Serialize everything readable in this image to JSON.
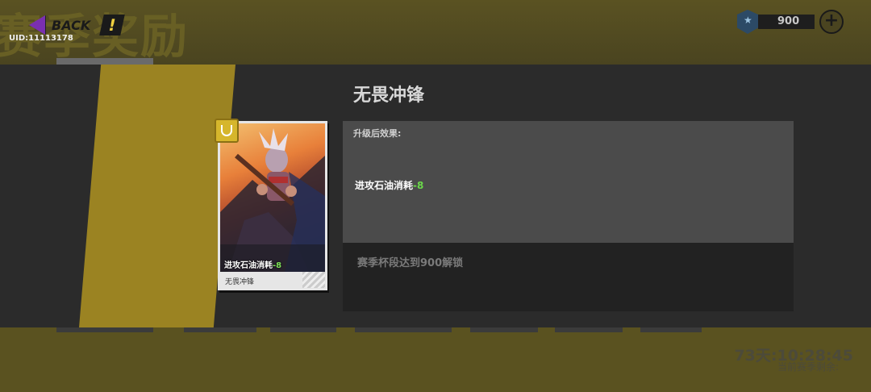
{
  "header": {
    "bg_title": "赛季奖励",
    "back_label": "BACK",
    "info_label": "!",
    "uid": "UID:11113178"
  },
  "currency": {
    "icon": "trophy-shield-icon",
    "value": "900",
    "add_label": "+"
  },
  "footer": {
    "timer": "73天:10:28:45",
    "timer_label": "当前赛季剩余:"
  },
  "card": {
    "badge_icon": "card-rarity-icon",
    "desc_prefix": "进攻石油消耗",
    "desc_value": "-8",
    "name": "无畏冲锋"
  },
  "panel": {
    "title": "无畏冲锋",
    "effect_label": "升级后效果:",
    "effect_prefix": "进攻石油消耗",
    "effect_value": "-8",
    "unlock_text": "赛季杯段达到900解锁"
  },
  "colors": {
    "accent_yellow": "#9b8322",
    "positive_green": "#6bd84a"
  }
}
